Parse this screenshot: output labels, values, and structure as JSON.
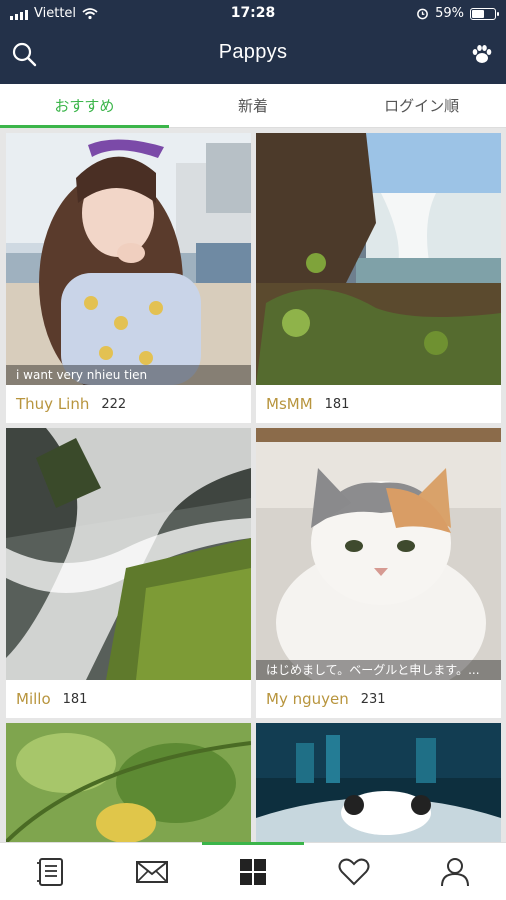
{
  "status": {
    "carrier": "Viettel",
    "time": "17:28",
    "battery": "59%",
    "battery_level": 0.59
  },
  "header": {
    "title": "Pappys"
  },
  "tabs": [
    {
      "label": "おすすめ",
      "active": true
    },
    {
      "label": "新着",
      "active": false
    },
    {
      "label": "ログイン順",
      "active": false
    }
  ],
  "cards": [
    {
      "name": "Thuy Linh",
      "count": "222",
      "caption": "i want very nhieu tien"
    },
    {
      "name": "MsMM",
      "count": "181",
      "caption": ""
    },
    {
      "name": "Millo",
      "count": "181",
      "caption": ""
    },
    {
      "name": "My nguyen",
      "count": "231",
      "caption": "はじめまして。ベーグルと申します。..."
    },
    {
      "name": "",
      "count": "",
      "caption": ""
    },
    {
      "name": "",
      "count": "",
      "caption": ""
    }
  ],
  "nav": [
    {
      "icon": "notebook-icon",
      "active": false
    },
    {
      "icon": "mail-icon",
      "active": false
    },
    {
      "icon": "grid-icon",
      "active": true
    },
    {
      "icon": "heart-icon",
      "active": false
    },
    {
      "icon": "profile-icon",
      "active": false
    }
  ],
  "colors": {
    "header_bg": "#233149",
    "accent": "#3bb54a",
    "name_color": "#b8953e"
  }
}
